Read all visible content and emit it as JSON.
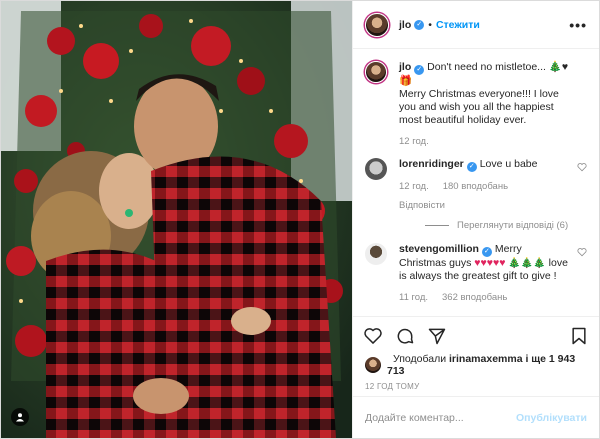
{
  "header": {
    "username": "jlo",
    "follow_label": "Стежити",
    "more_label": "•••"
  },
  "caption": {
    "username": "jlo",
    "line1": "Don't need no mistletoe... 🎄♥🎁",
    "text": "Merry Christmas everyone!!! I love you and wish you all the happiest most beautiful holiday ever.",
    "age": "12 год."
  },
  "comments": [
    {
      "username": "lorenridinger",
      "text": "Love u babe",
      "age": "12 год.",
      "likes": "180 вподобань",
      "reply_label": "Відповісти",
      "view_replies": "Переглянути відповіді (6)"
    },
    {
      "username": "stevengomillion",
      "text_a": "Merry Christmas guys",
      "text_b": "love is always the greatest gift to give !",
      "age": "11 год.",
      "likes": "362 вподобань"
    }
  ],
  "likes": {
    "text_prefix": "Уподобали",
    "user": "irinamaxemma",
    "text_suffix": "і ще 1 943 713"
  },
  "timestamp": "12 ГОД ТОМУ",
  "add_comment": {
    "placeholder": "Додайте коментар...",
    "post_label": "Опублікувати"
  },
  "icons": [
    "heart-icon",
    "comment-icon",
    "share-icon",
    "bookmark-icon",
    "verified-icon",
    "user-tag-icon"
  ],
  "colors": {
    "accent": "#0095f6",
    "verified": "#3897f0",
    "muted": "#8e8e8e",
    "heart": "#e0245e"
  }
}
